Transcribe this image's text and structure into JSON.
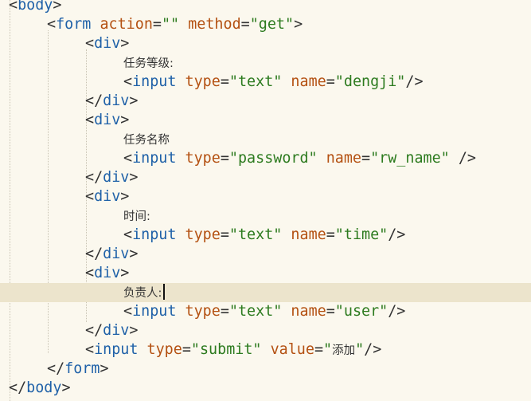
{
  "editor": {
    "lines": [
      {
        "indent": 0,
        "tokens": [
          {
            "k": "p",
            "v": "<"
          },
          {
            "k": "t",
            "v": "body"
          },
          {
            "k": "p",
            "v": ">"
          }
        ]
      },
      {
        "indent": 1,
        "tokens": [
          {
            "k": "p",
            "v": "<"
          },
          {
            "k": "t",
            "v": "form"
          },
          {
            "k": "p",
            "v": " "
          },
          {
            "k": "a",
            "v": "action"
          },
          {
            "k": "p",
            "v": "="
          },
          {
            "k": "s",
            "v": "\"\""
          },
          {
            "k": "p",
            "v": " "
          },
          {
            "k": "a",
            "v": "method"
          },
          {
            "k": "p",
            "v": "="
          },
          {
            "k": "s",
            "v": "\"get\""
          },
          {
            "k": "p",
            "v": ">"
          }
        ]
      },
      {
        "indent": 2,
        "tokens": [
          {
            "k": "p",
            "v": "<"
          },
          {
            "k": "t",
            "v": "div"
          },
          {
            "k": "p",
            "v": ">"
          }
        ]
      },
      {
        "indent": 3,
        "tokens": [
          {
            "k": "cn",
            "v": "任务等级:"
          }
        ]
      },
      {
        "indent": 3,
        "tokens": [
          {
            "k": "p",
            "v": "<"
          },
          {
            "k": "t",
            "v": "input"
          },
          {
            "k": "p",
            "v": " "
          },
          {
            "k": "a",
            "v": "type"
          },
          {
            "k": "p",
            "v": "="
          },
          {
            "k": "s",
            "v": "\"text\""
          },
          {
            "k": "p",
            "v": " "
          },
          {
            "k": "a",
            "v": "name"
          },
          {
            "k": "p",
            "v": "="
          },
          {
            "k": "s",
            "v": "\"dengji\""
          },
          {
            "k": "p",
            "v": "/>"
          }
        ]
      },
      {
        "indent": 2,
        "tokens": [
          {
            "k": "p",
            "v": "</"
          },
          {
            "k": "t",
            "v": "div"
          },
          {
            "k": "p",
            "v": ">"
          }
        ]
      },
      {
        "indent": 2,
        "tokens": [
          {
            "k": "p",
            "v": "<"
          },
          {
            "k": "t",
            "v": "div"
          },
          {
            "k": "p",
            "v": ">"
          }
        ]
      },
      {
        "indent": 3,
        "tokens": [
          {
            "k": "cn",
            "v": "任务名称"
          }
        ]
      },
      {
        "indent": 3,
        "tokens": [
          {
            "k": "p",
            "v": "<"
          },
          {
            "k": "t",
            "v": "input"
          },
          {
            "k": "p",
            "v": " "
          },
          {
            "k": "a",
            "v": "type"
          },
          {
            "k": "p",
            "v": "="
          },
          {
            "k": "s",
            "v": "\"password\""
          },
          {
            "k": "p",
            "v": " "
          },
          {
            "k": "a",
            "v": "name"
          },
          {
            "k": "p",
            "v": "="
          },
          {
            "k": "s",
            "v": "\"rw_name\""
          },
          {
            "k": "p",
            "v": " />"
          }
        ]
      },
      {
        "indent": 2,
        "tokens": [
          {
            "k": "p",
            "v": "</"
          },
          {
            "k": "t",
            "v": "div"
          },
          {
            "k": "p",
            "v": ">"
          }
        ]
      },
      {
        "indent": 2,
        "tokens": [
          {
            "k": "p",
            "v": "<"
          },
          {
            "k": "t",
            "v": "div"
          },
          {
            "k": "p",
            "v": ">"
          }
        ]
      },
      {
        "indent": 3,
        "tokens": [
          {
            "k": "cn",
            "v": "时间:"
          }
        ]
      },
      {
        "indent": 3,
        "tokens": [
          {
            "k": "p",
            "v": "<"
          },
          {
            "k": "t",
            "v": "input"
          },
          {
            "k": "p",
            "v": " "
          },
          {
            "k": "a",
            "v": "type"
          },
          {
            "k": "p",
            "v": "="
          },
          {
            "k": "s",
            "v": "\"text\""
          },
          {
            "k": "p",
            "v": " "
          },
          {
            "k": "a",
            "v": "name"
          },
          {
            "k": "p",
            "v": "="
          },
          {
            "k": "s",
            "v": "\"time\""
          },
          {
            "k": "p",
            "v": "/>"
          }
        ]
      },
      {
        "indent": 2,
        "tokens": [
          {
            "k": "p",
            "v": "</"
          },
          {
            "k": "t",
            "v": "div"
          },
          {
            "k": "p",
            "v": ">"
          }
        ]
      },
      {
        "indent": 2,
        "tokens": [
          {
            "k": "p",
            "v": "<"
          },
          {
            "k": "t",
            "v": "div"
          },
          {
            "k": "p",
            "v": ">"
          }
        ]
      },
      {
        "indent": 3,
        "current": true,
        "tokens": [
          {
            "k": "cn",
            "v": "负责人:"
          }
        ]
      },
      {
        "indent": 3,
        "tokens": [
          {
            "k": "p",
            "v": "<"
          },
          {
            "k": "t",
            "v": "input"
          },
          {
            "k": "p",
            "v": " "
          },
          {
            "k": "a",
            "v": "type"
          },
          {
            "k": "p",
            "v": "="
          },
          {
            "k": "s",
            "v": "\"text\""
          },
          {
            "k": "p",
            "v": " "
          },
          {
            "k": "a",
            "v": "name"
          },
          {
            "k": "p",
            "v": "="
          },
          {
            "k": "s",
            "v": "\"user\""
          },
          {
            "k": "p",
            "v": "/>"
          }
        ]
      },
      {
        "indent": 2,
        "tokens": [
          {
            "k": "p",
            "v": "</"
          },
          {
            "k": "t",
            "v": "div"
          },
          {
            "k": "p",
            "v": ">"
          }
        ]
      },
      {
        "indent": 2,
        "tokens": [
          {
            "k": "p",
            "v": "<"
          },
          {
            "k": "t",
            "v": "input"
          },
          {
            "k": "p",
            "v": " "
          },
          {
            "k": "a",
            "v": "type"
          },
          {
            "k": "p",
            "v": "="
          },
          {
            "k": "s",
            "v": "\"submit\""
          },
          {
            "k": "p",
            "v": " "
          },
          {
            "k": "a",
            "v": "value"
          },
          {
            "k": "p",
            "v": "="
          },
          {
            "k": "s",
            "v": "\""
          },
          {
            "k": "cn",
            "v": "添加"
          },
          {
            "k": "s",
            "v": "\""
          },
          {
            "k": "p",
            "v": "/>"
          }
        ]
      },
      {
        "indent": 1,
        "tokens": [
          {
            "k": "p",
            "v": "</"
          },
          {
            "k": "t",
            "v": "form"
          },
          {
            "k": "p",
            "v": ">"
          }
        ]
      },
      {
        "indent": 0,
        "tokens": [
          {
            "k": "p",
            "v": "</"
          },
          {
            "k": "t",
            "v": "body"
          },
          {
            "k": "p",
            "v": ">"
          }
        ]
      }
    ]
  },
  "colors": {
    "background": "#fbf8ee",
    "current_line": "#ece4cc",
    "tag": "#1f61a8",
    "attribute": "#b45112",
    "string": "#2d7b1f",
    "punctuation": "#333333"
  }
}
